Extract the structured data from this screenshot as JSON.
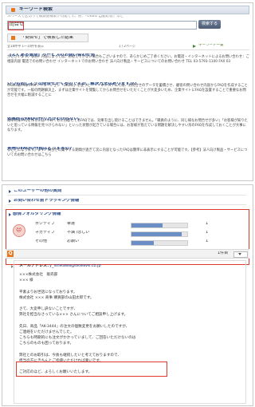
{
  "panel1": {
    "header_title": "キーワード検索",
    "hint": "スペースで区切って複数語検索が可能です。例：「OKBiz 自動応答」など",
    "search_value": "問合せ",
    "search_button": "検索する",
    "result_tab": "「問合せ」で検索した結果",
    "meta_left": "全18件中 1～10件を表示",
    "meta_mid": "1 / 2ページ",
    "meta_right": "キーワード一覧",
    "results": [
      {
        "title": "【よくある質問】サービスのお問い合わせ先",
        "body": "がございます。なお、内容によっては、お答えできない場合もございますので、あらかじめご了承ください。お電話・インターネットによるお問い合わせ：ご相談内容 電話でのお問い合わせ インターネットでのお問い合わせ 法人向け製品・サービスについてのお問い合わせ TEL 03-5793-1100 FAX 03"
      },
      {
        "title": "いつも同じような問合せがくるのですが、解決方法はありますか?",
        "body": "OKBizはFAQ/CRMソリューション「OKBiz」を使うと・・・ネシステムでは、お問合せのデータを蓄積させ、顧客の問い合わせ内容からFAQを作成することが可能です。一般の問題解決上、まずは企業サイトを閲覧してからお問合せをいただくことが大変多いため、企業サイトにFAQを設置することで重要なお問合せを大幅に削減することに"
      },
      {
        "title": "効率的なFAQの作り方がわからない。",
        "body": "効率的なFAQを作るには?やみくもに用意してもFAQでは、効果を出し続けることはできません。「職員のように、同じ様なお問合せが多い」「お客様が知りたいと思っている情報を見つけられない」といった状態が起きている場合には、お客様が抱えている問題を解決しやすい形のFAQを作成しておくことが大事になります。"
      },
      {
        "title": "実際のFAQの作成はどうするの?",
        "body": "ることになります。まず、問合せの集中する期間が過ぎて次に内容となったFAQは簡単に非表示にすることが可能です。【参考】法人向け製品・サービスについてのお問い合わせはこちら"
      }
    ]
  },
  "panel2": {
    "sections": [
      "このユーザーの他の質問",
      "お問い合わせ前トラッキング情報"
    ],
    "context_title": "感情フォルダリング情報",
    "context_rows": [
      {
        "key": "ポジティブ",
        "val": "幸運",
        "pct": 0.55,
        "num": "1"
      },
      {
        "key": "ネガティブ",
        "val": "不満 /悲しい",
        "pct": 0.9,
        "num": "1"
      },
      {
        "key": "その他",
        "val": "お願い",
        "pct": 0.4,
        "num": "1"
      }
    ],
    "mail_count": "1件目",
    "mail_from_label": "メールアドレス：",
    "mail_from_value": "y_ishikawa@okwave.co.jp",
    "mail_lines": [
      "×××株式会社　販売部",
      "××× 様",
      "",
      "平素よりお世話になっております。",
      "株式会社 ××× 商事 購買部の山田太郎です。",
      "",
      "さて、大変申し訳ないことですが、",
      "弊社を担当なさっている××× さんについてご相談申し上げます。",
      "",
      "先日、商品「AK-3444」の注文の個数変更をお願いしたのですが、",
      "ご連絡をいただけませんでした。",
      "こちらも時期的にも注文がかかっていまして、ご回答いただけないのは",
      "こちらのものも困っております。",
      "",
      "弊社とのお取引は、今後も継続したいと考えておりますので、",
      "担当の方にきちんとご指導いただければ幸いです。",
      "",
      "ご対応のほど、よろしくお願いいたします。"
    ]
  }
}
